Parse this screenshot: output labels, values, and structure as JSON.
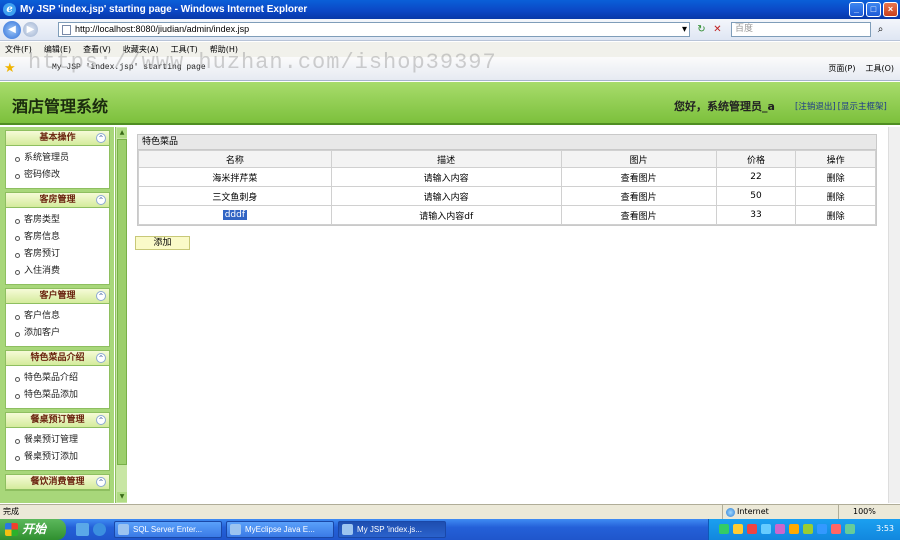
{
  "window": {
    "title": "My JSP 'index.jsp' starting page - Windows Internet Explorer",
    "ie_glyph": "e",
    "min": "_",
    "max": "□",
    "close": "×"
  },
  "browser": {
    "back_glyph": "◀",
    "forward_glyph": "▶",
    "url": "http://localhost:8080/jiudian/admin/index.jsp",
    "dropdown_glyph": "▾",
    "refresh_glyph": "↻",
    "stop_glyph": "✕",
    "search_placeholder": "百度",
    "search_btn": "⌕",
    "menu": [
      "文件(F)",
      "编辑(E)",
      "查看(V)",
      "收藏夹(A)",
      "工具(T)",
      "帮助(H)"
    ],
    "tab_title": "My JSP 'index.jsp' starting page",
    "tools": [
      "页面(P)",
      "工具(O)"
    ],
    "watermark": "https://www.huzhan.com/ishop39397"
  },
  "app": {
    "system_name": "酒店管理系统",
    "greeting": "您好，系统管理员_a",
    "logout": "[注销退出]",
    "show_hide": "[显示主框架]",
    "colors": {
      "header": "#8cc84e",
      "sidebar": "#a8d77a",
      "group_title": "#6b2410"
    }
  },
  "sidebar": {
    "groups": [
      {
        "title": "基本操作",
        "items": [
          "系统管理员",
          "密码修改"
        ]
      },
      {
        "title": "客房管理",
        "items": [
          "客房类型",
          "客房信息",
          "客房预订",
          "入住消费"
        ]
      },
      {
        "title": "客户管理",
        "items": [
          "客户信息",
          "添加客户"
        ]
      },
      {
        "title": "特色菜品介绍",
        "items": [
          "特色菜品介绍",
          "特色菜品添加"
        ]
      },
      {
        "title": "餐桌预订管理",
        "items": [
          "餐桌预订管理",
          "餐桌预订添加"
        ]
      },
      {
        "title": "餐饮消费管理",
        "items": []
      }
    ],
    "collapse_glyph": "^"
  },
  "main": {
    "table_title": "特色菜品",
    "columns": [
      "名称",
      "描述",
      "图片",
      "价格",
      "操作"
    ],
    "rows": [
      {
        "name": "海米拌芹菜",
        "desc": "请输入内容",
        "image": "查看图片",
        "price": "22",
        "action": "删除"
      },
      {
        "name": "三文鱼刺身",
        "desc": "请输入内容",
        "image": "查看图片",
        "price": "50",
        "action": "删除"
      },
      {
        "name": "dddf",
        "desc": "请输入内容df",
        "image": "查看图片",
        "price": "33",
        "action": "删除"
      }
    ],
    "add_button": "添加"
  },
  "status": {
    "text": "完成",
    "zone": "Internet",
    "zoom": "100%"
  },
  "taskbar": {
    "start": "开始",
    "tasks": [
      "SQL Server Enter...",
      "MyEclipse Java E...",
      "My JSP 'index.js..."
    ],
    "clock": "3:53"
  }
}
